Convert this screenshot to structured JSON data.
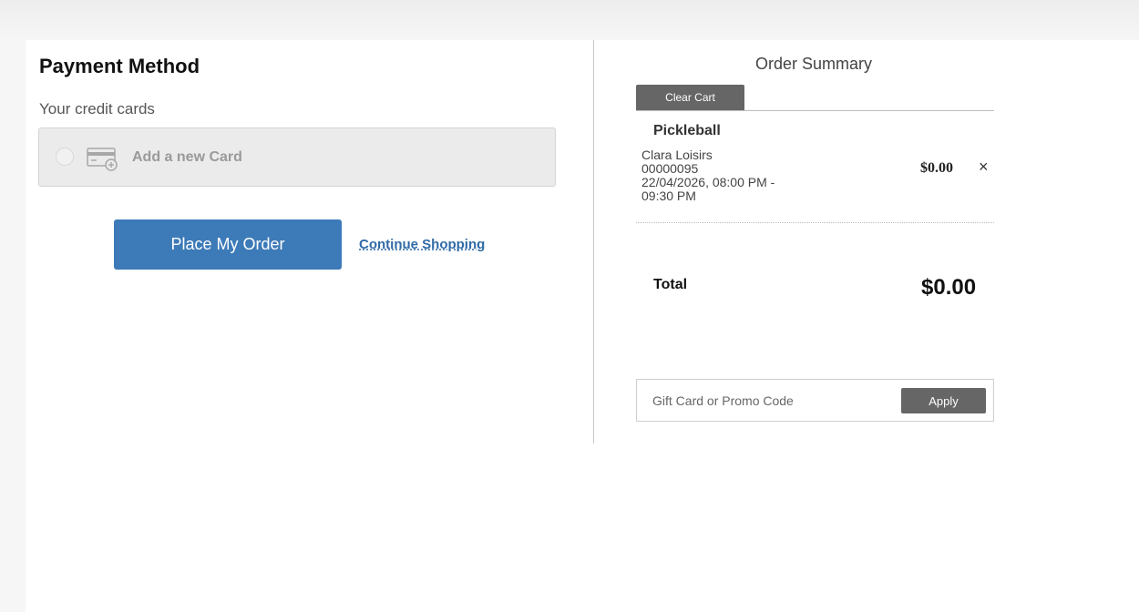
{
  "payment": {
    "title": "Payment Method",
    "cards_label": "Your credit cards",
    "add_card_label": "Add a new Card",
    "add_card_icon": "credit-card-add-icon",
    "place_order_label": "Place My Order",
    "continue_label": "Continue Shopping"
  },
  "summary": {
    "title": "Order Summary",
    "clear_cart_label": "Clear Cart",
    "items": [
      {
        "name": "Pickleball",
        "customer": "Clara Loisirs",
        "number": "00000095",
        "schedule_line1": "22/04/2026, 08:00 PM -",
        "schedule_line2": "09:30 PM",
        "price": "$0.00",
        "remove_symbol": "×"
      }
    ],
    "total_label": "Total",
    "total_value": "$0.00",
    "promo_placeholder": "Gift Card or Promo Code",
    "promo_value": "",
    "apply_label": "Apply"
  },
  "colors": {
    "primary_button": "#3d7ab8",
    "secondary_button": "#666666",
    "link": "#2f6aa6",
    "page_background": "#f6f6f6"
  }
}
